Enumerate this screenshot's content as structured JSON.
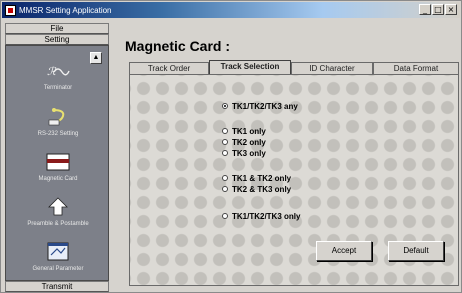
{
  "window": {
    "title": "MMSR Setting Application",
    "minimize_glyph": "_",
    "maximize_glyph": "□",
    "close_glyph": "×"
  },
  "sidebar": {
    "file_label": "File",
    "setting_label": "Setting",
    "scroll_up_glyph": "▲",
    "items": [
      {
        "label": "Terminator",
        "icon": "terminator-icon"
      },
      {
        "label": "RS-232 Setting",
        "icon": "rs232-cable-icon"
      },
      {
        "label": "Magnetic Card",
        "icon": "magnetic-card-icon"
      },
      {
        "label": "Preamble & Postamble",
        "icon": "preamble-arrow-icon"
      },
      {
        "label": "General Parameter",
        "icon": "general-parameter-icon"
      }
    ],
    "transmit_label": "Transmit"
  },
  "main": {
    "title": "Magnetic Card :",
    "tabs": [
      {
        "label": "Track Order",
        "active": false
      },
      {
        "label": "Track Selection",
        "active": true
      },
      {
        "label": "ID Character",
        "active": false
      },
      {
        "label": "Data Format",
        "active": false
      }
    ],
    "options": [
      {
        "label": "TK1/TK2/TK3 any",
        "checked": true
      },
      {
        "label": "TK1 only",
        "checked": false
      },
      {
        "label": "TK2 only",
        "checked": false
      },
      {
        "label": "TK3 only",
        "checked": false
      },
      {
        "label": "TK1 & TK2 only",
        "checked": false
      },
      {
        "label": "TK2 & TK3 only",
        "checked": false
      },
      {
        "label": "TK1/TK2/TK3 only",
        "checked": false
      }
    ],
    "accept_label": "Accept",
    "default_label": "Default"
  }
}
